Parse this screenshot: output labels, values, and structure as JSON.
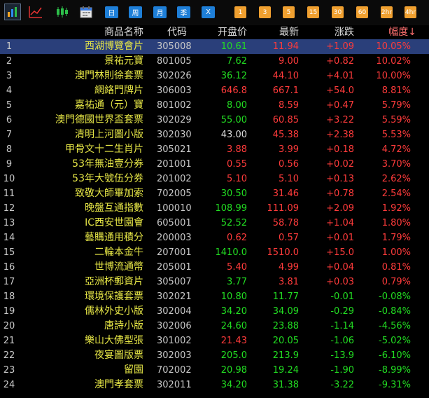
{
  "toolbar": {
    "period_buttons": [
      "日",
      "周",
      "月",
      "季",
      "X"
    ],
    "minute_buttons": [
      "1",
      "3",
      "5",
      "15",
      "30",
      "60",
      "2hr",
      "4hr"
    ]
  },
  "header": {
    "name": "商品名称",
    "code": "代码",
    "open": "开盘价",
    "latest": "最新",
    "change": "涨跌",
    "amplitude": "幅度↓"
  },
  "colors": {
    "up": "#ff3b3b",
    "down": "#22dd22",
    "flat": "#dcdcdc",
    "name": "#e6e646",
    "selected_row": "#2a3f7a"
  },
  "rows": [
    {
      "idx": "1",
      "name": "西湖博覽會片",
      "code": "305008",
      "open": "10.61",
      "latest": "11.94",
      "change": "+1.09",
      "amp": "10.05%",
      "open_c": "green",
      "latest_c": "red",
      "chg_c": "red",
      "amp_c": "red"
    },
    {
      "idx": "2",
      "name": "景祐元寶",
      "code": "801005",
      "open": "7.62",
      "latest": "9.00",
      "change": "+0.82",
      "amp": "10.02%",
      "open_c": "green",
      "latest_c": "red",
      "chg_c": "red",
      "amp_c": "red"
    },
    {
      "idx": "3",
      "name": "澳門林則徐套票",
      "code": "302026",
      "open": "36.12",
      "latest": "44.10",
      "change": "+4.01",
      "amp": "10.00%",
      "open_c": "green",
      "latest_c": "red",
      "chg_c": "red",
      "amp_c": "red"
    },
    {
      "idx": "4",
      "name": "網絡門牌片",
      "code": "306003",
      "open": "646.8",
      "latest": "667.1",
      "change": "+54.0",
      "amp": "8.81%",
      "open_c": "red",
      "latest_c": "red",
      "chg_c": "red",
      "amp_c": "red"
    },
    {
      "idx": "5",
      "name": "嘉祐通（元）寶",
      "code": "801002",
      "open": "8.00",
      "latest": "8.59",
      "change": "+0.47",
      "amp": "5.79%",
      "open_c": "green",
      "latest_c": "red",
      "chg_c": "red",
      "amp_c": "red"
    },
    {
      "idx": "6",
      "name": "澳門德國世界盃套票",
      "code": "302029",
      "open": "55.00",
      "latest": "60.85",
      "change": "+3.22",
      "amp": "5.59%",
      "open_c": "green",
      "latest_c": "red",
      "chg_c": "red",
      "amp_c": "red"
    },
    {
      "idx": "7",
      "name": "清明上河圖小版",
      "code": "302030",
      "open": "43.00",
      "latest": "45.38",
      "change": "+2.38",
      "amp": "5.53%",
      "open_c": "white",
      "latest_c": "red",
      "chg_c": "red",
      "amp_c": "red"
    },
    {
      "idx": "8",
      "name": "甲骨文十二生肖片",
      "code": "305021",
      "open": "3.88",
      "latest": "3.99",
      "change": "+0.18",
      "amp": "4.72%",
      "open_c": "red",
      "latest_c": "red",
      "chg_c": "red",
      "amp_c": "red"
    },
    {
      "idx": "9",
      "name": "53年無油壹分券",
      "code": "201001",
      "open": "0.55",
      "latest": "0.56",
      "change": "+0.02",
      "amp": "3.70%",
      "open_c": "red",
      "latest_c": "red",
      "chg_c": "red",
      "amp_c": "red"
    },
    {
      "idx": "10",
      "name": "53年大號伍分券",
      "code": "201002",
      "open": "5.10",
      "latest": "5.10",
      "change": "+0.13",
      "amp": "2.62%",
      "open_c": "red",
      "latest_c": "red",
      "chg_c": "red",
      "amp_c": "red"
    },
    {
      "idx": "11",
      "name": "致敬大師畢加索",
      "code": "702005",
      "open": "30.50",
      "latest": "31.46",
      "change": "+0.78",
      "amp": "2.54%",
      "open_c": "green",
      "latest_c": "red",
      "chg_c": "red",
      "amp_c": "red"
    },
    {
      "idx": "12",
      "name": "晚盤互通指數",
      "code": "100010",
      "open": "108.99",
      "latest": "111.09",
      "change": "+2.09",
      "amp": "1.92%",
      "open_c": "green",
      "latest_c": "red",
      "chg_c": "red",
      "amp_c": "red"
    },
    {
      "idx": "13",
      "name": "IC西安世園會",
      "code": "605001",
      "open": "52.52",
      "latest": "58.78",
      "change": "+1.04",
      "amp": "1.80%",
      "open_c": "green",
      "latest_c": "red",
      "chg_c": "red",
      "amp_c": "red"
    },
    {
      "idx": "14",
      "name": "藝購通用積分",
      "code": "200003",
      "open": "0.62",
      "latest": "0.57",
      "change": "+0.01",
      "amp": "1.79%",
      "open_c": "red",
      "latest_c": "red",
      "chg_c": "red",
      "amp_c": "red"
    },
    {
      "idx": "15",
      "name": "二輪本金牛",
      "code": "207001",
      "open": "1410.0",
      "latest": "1510.0",
      "change": "+15.0",
      "amp": "1.00%",
      "open_c": "green",
      "latest_c": "red",
      "chg_c": "red",
      "amp_c": "red"
    },
    {
      "idx": "16",
      "name": "世博流通幣",
      "code": "205001",
      "open": "5.40",
      "latest": "4.99",
      "change": "+0.04",
      "amp": "0.81%",
      "open_c": "red",
      "latest_c": "red",
      "chg_c": "red",
      "amp_c": "red"
    },
    {
      "idx": "17",
      "name": "亞洲杯郵資片",
      "code": "305007",
      "open": "3.77",
      "latest": "3.81",
      "change": "+0.03",
      "amp": "0.79%",
      "open_c": "green",
      "latest_c": "red",
      "chg_c": "red",
      "amp_c": "red"
    },
    {
      "idx": "18",
      "name": "環境保護套票",
      "code": "302021",
      "open": "10.80",
      "latest": "11.77",
      "change": "-0.01",
      "amp": "-0.08%",
      "open_c": "green",
      "latest_c": "green",
      "chg_c": "green",
      "amp_c": "green"
    },
    {
      "idx": "19",
      "name": "儒林外史小版",
      "code": "302004",
      "open": "34.20",
      "latest": "34.09",
      "change": "-0.29",
      "amp": "-0.84%",
      "open_c": "green",
      "latest_c": "green",
      "chg_c": "green",
      "amp_c": "green"
    },
    {
      "idx": "20",
      "name": "唐詩小版",
      "code": "302006",
      "open": "24.60",
      "latest": "23.88",
      "change": "-1.14",
      "amp": "-4.56%",
      "open_c": "green",
      "latest_c": "green",
      "chg_c": "green",
      "amp_c": "green"
    },
    {
      "idx": "21",
      "name": "樂山大佛型張",
      "code": "301002",
      "open": "21.43",
      "latest": "20.05",
      "change": "-1.06",
      "amp": "-5.02%",
      "open_c": "red",
      "latest_c": "green",
      "chg_c": "green",
      "amp_c": "green"
    },
    {
      "idx": "22",
      "name": "夜宴圖版票",
      "code": "302003",
      "open": "205.0",
      "latest": "213.9",
      "change": "-13.9",
      "amp": "-6.10%",
      "open_c": "green",
      "latest_c": "green",
      "chg_c": "green",
      "amp_c": "green"
    },
    {
      "idx": "23",
      "name": "留園",
      "code": "702002",
      "open": "20.98",
      "latest": "19.24",
      "change": "-1.90",
      "amp": "-8.99%",
      "open_c": "green",
      "latest_c": "green",
      "chg_c": "green",
      "amp_c": "green"
    },
    {
      "idx": "24",
      "name": "澳門孝套票",
      "code": "302011",
      "open": "34.20",
      "latest": "31.38",
      "change": "-3.22",
      "amp": "-9.31%",
      "open_c": "green",
      "latest_c": "green",
      "chg_c": "green",
      "amp_c": "green"
    }
  ]
}
